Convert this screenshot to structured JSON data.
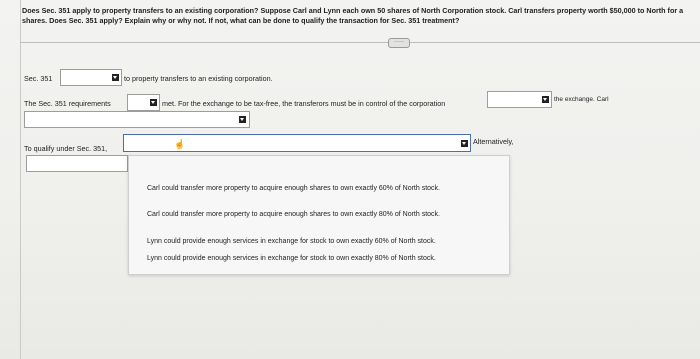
{
  "question": {
    "line1": "Does Sec. 351 apply to property transfers to an existing corporation? Suppose Carl and Lynn each own 50 shares of North Corporation stock. Carl transfers property worth $50,000 to North for a",
    "line2": "shares. Does Sec. 351 apply? Explain why or why not. If not, what can be done to qualify the transaction for Sec. 351 treatment?"
  },
  "toolbar": {
    "expand_label": "·····"
  },
  "row1": {
    "label": "Sec. 351",
    "suffix": "to property transfers to an existing corporation."
  },
  "row2": {
    "label": "The Sec. 351 requirements",
    "middle": "met. For the exchange to be tax-free, the transferors must be in control of the corporation",
    "suffix": "the exchange. Carl"
  },
  "row3": {
    "label": "To qualify under Sec. 351,",
    "suffix": "Alternatively,"
  },
  "dropdown_options": [
    "Carl could transfer more property to acquire enough shares to own exactly 60% of North stock.",
    "Carl could transfer more property to acquire enough shares to own exactly 80% of North stock.",
    "Lynn could provide enough services in exchange for stock to own exactly 60% of North stock.",
    "Lynn could provide enough services in exchange for stock to own exactly 80% of North stock."
  ],
  "icons": {
    "dropdown": "dropdown-arrow-icon",
    "cursor": "hand-cursor-icon"
  },
  "colors": {
    "active_border": "#4a6ea8"
  }
}
